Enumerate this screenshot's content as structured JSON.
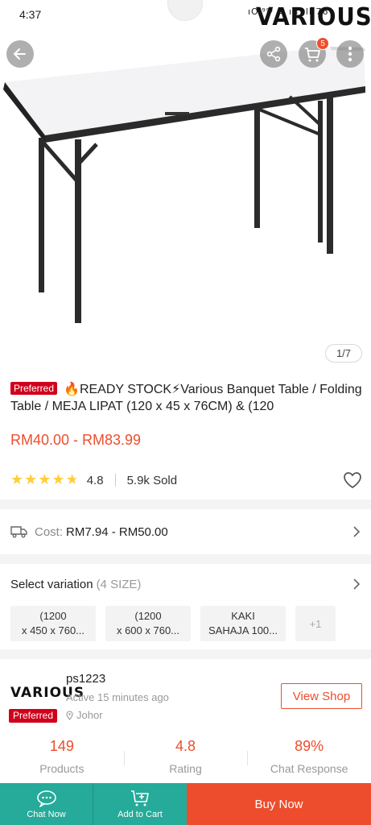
{
  "status_bar": {
    "time": "4:37",
    "icons": "ıO⁽⁹⁹⁾ ≋ ıll ıll 76"
  },
  "brand_logo": "VARIOUS",
  "header": {
    "cart_badge": "5",
    "image_counter": "1/7"
  },
  "product": {
    "preferred_label": "Preferred",
    "title": "🔥READY STOCK⚡Various Banquet Table / Folding Table / MEJA LIPAT (120 x 45 x 76CM) & (120",
    "price": "RM40.00 - RM83.99",
    "rating": "4.8",
    "stars_filled": 4.8,
    "sold": "5.9k Sold"
  },
  "shipping": {
    "label": "Cost:",
    "value": "RM7.94 - RM50.00"
  },
  "variation": {
    "title": "Select variation",
    "count": "(4 SIZE)",
    "options": [
      "(1200\nx 450 x 760...",
      "(1200\nx 600 x 760...",
      "KAKI\nSAHAJA 100..."
    ],
    "more": "+1"
  },
  "shop": {
    "logo": "VARIOUS",
    "preferred_label": "Preferred",
    "name": "ps1223",
    "active": "Active 15 minutes ago",
    "location": "Johor",
    "view_shop": "View Shop",
    "stats": [
      {
        "value": "149",
        "label": "Products"
      },
      {
        "value": "4.8",
        "label": "Rating"
      },
      {
        "value": "89%",
        "label": "Chat Response"
      }
    ]
  },
  "bottom_bar": {
    "chat": "Chat Now",
    "add_to_cart": "Add to Cart",
    "buy_now": "Buy Now"
  },
  "colors": {
    "accent": "#ee4d2d",
    "preferred": "#d0011b",
    "teal": "#26aa99",
    "star": "#ffce3d"
  }
}
